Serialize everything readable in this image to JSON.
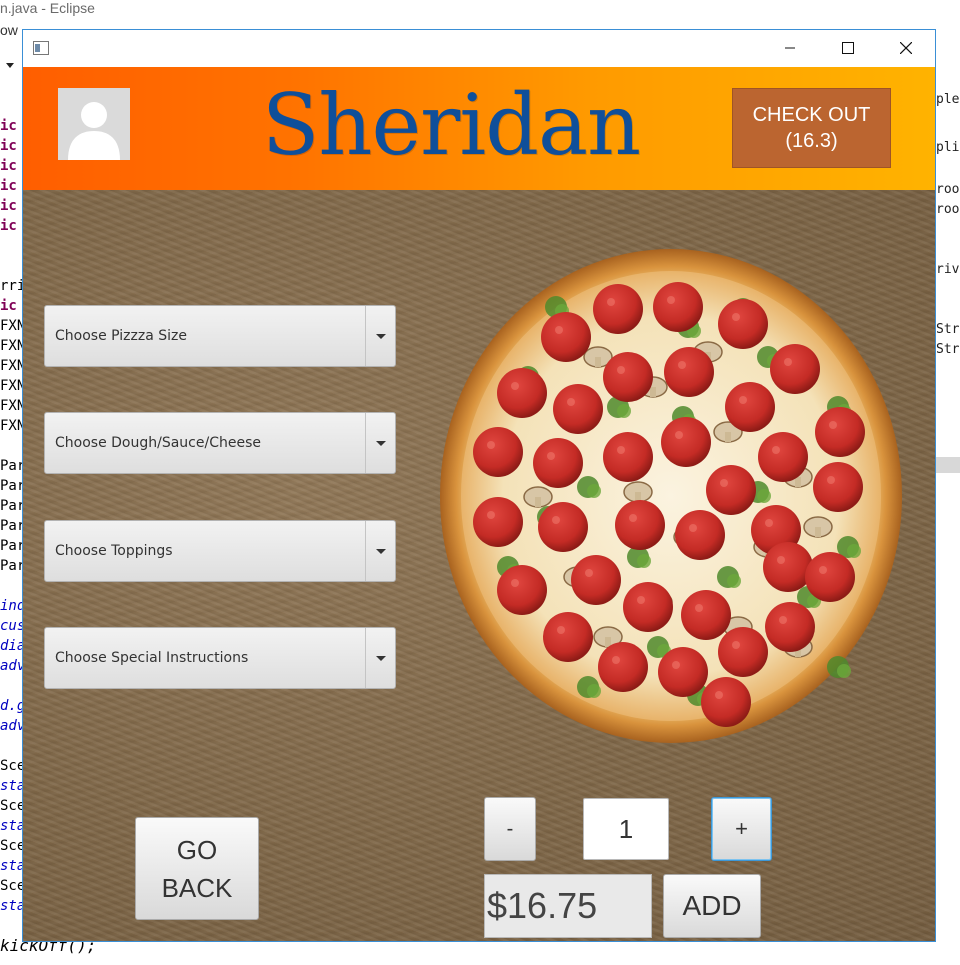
{
  "eclipse": {
    "title": "n.java - Eclipse",
    "menu_fragment": "ow",
    "left_code_lines": [
      {
        "text": "ic",
        "style": "kw"
      },
      {
        "text": "ic",
        "style": "kw"
      },
      {
        "text": "ic",
        "style": "kw"
      },
      {
        "text": "ic",
        "style": "kw"
      },
      {
        "text": "ic",
        "style": "kw"
      },
      {
        "text": "ic",
        "style": "kw"
      },
      {
        "text": "rri",
        "style": "pl"
      },
      {
        "text": "ic",
        "style": "kw"
      },
      {
        "text": "FXN",
        "style": "pl"
      },
      {
        "text": "FXN",
        "style": "pl"
      },
      {
        "text": "FXN",
        "style": "pl"
      },
      {
        "text": "FXN",
        "style": "pl"
      },
      {
        "text": "FXN",
        "style": "pl"
      },
      {
        "text": "FXN",
        "style": "pl"
      },
      {
        "text": "Par",
        "style": "pl"
      },
      {
        "text": "Par",
        "style": "pl"
      },
      {
        "text": "Par",
        "style": "pl"
      },
      {
        "text": "Par",
        "style": "pl"
      },
      {
        "text": "Par",
        "style": "pl"
      },
      {
        "text": "Par",
        "style": "pl"
      },
      {
        "text": "ind",
        "style": "it"
      },
      {
        "text": "cus",
        "style": "it"
      },
      {
        "text": "dia",
        "style": "it"
      },
      {
        "text": "adv",
        "style": "it"
      },
      {
        "text": "d.g",
        "style": "it"
      },
      {
        "text": "adv",
        "style": "it"
      },
      {
        "text": "Sce",
        "style": "pl"
      },
      {
        "text": "sta",
        "style": "it"
      },
      {
        "text": "Sce",
        "style": "pl"
      },
      {
        "text": "sta",
        "style": "it"
      },
      {
        "text": "Sce",
        "style": "pl"
      },
      {
        "text": "sta",
        "style": "it"
      },
      {
        "text": "Sce",
        "style": "pl"
      },
      {
        "text": "sta",
        "style": "it"
      }
    ],
    "bottom_code": "kickOff();",
    "right_fragments": [
      "plem",
      "plic",
      "roon",
      "roon",
      "rive",
      "Stri",
      "Stri"
    ]
  },
  "window": {
    "icon": "app-window-icon",
    "controls": [
      "minimize-icon",
      "maximize-icon",
      "close-icon"
    ]
  },
  "header": {
    "brand": "Sheridan",
    "checkout_line1": "CHECK OUT",
    "checkout_line2": "(16.3)",
    "avatar_icon": "user-avatar-icon"
  },
  "options": {
    "size_prompt": "Choose Pizzza Size",
    "base_prompt": "Choose Dough/Sauce/Cheese",
    "toppings_prompt": "Choose Toppings",
    "instructions_prompt": "Choose Special Instructions"
  },
  "controls": {
    "go_back_line1": "GO",
    "go_back_line2": "BACK",
    "minus": "-",
    "quantity": "1",
    "plus": "+",
    "price": "$16.75",
    "add": "ADD"
  },
  "colors": {
    "header_start": "#ff5e00",
    "header_end": "#ffb300",
    "brand_blue": "#0f4f9a",
    "checkout_bg": "#bb6530",
    "focus_blue": "#3d98d8"
  }
}
